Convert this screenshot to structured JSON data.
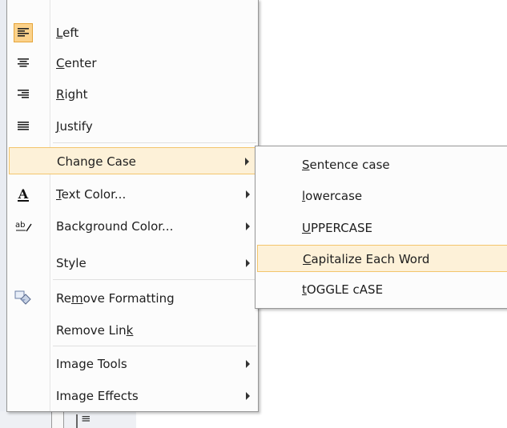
{
  "main_menu": {
    "items": [
      {
        "id": "left",
        "pre": "",
        "acc": "L",
        "post": "eft",
        "icon": "align-left-icon"
      },
      {
        "id": "center",
        "pre": "",
        "acc": "C",
        "post": "enter",
        "icon": "align-center-icon"
      },
      {
        "id": "right",
        "pre": "",
        "acc": "R",
        "post": "ight",
        "icon": "align-right-icon"
      },
      {
        "id": "justify",
        "pre": "",
        "acc": "J",
        "post": "ustify",
        "icon": "align-justify-icon"
      },
      {
        "id": "change-case",
        "label": "Change Case"
      },
      {
        "id": "text-color",
        "pre": "",
        "acc": "T",
        "post": "ext Color...",
        "icon": "text-color-icon"
      },
      {
        "id": "background-color",
        "label": "Background Color...",
        "icon": "background-color-icon"
      },
      {
        "id": "style",
        "label": "Style"
      },
      {
        "id": "remove-formatting",
        "pre": "Re",
        "acc": "m",
        "post": "ove Formatting",
        "icon": "remove-formatting-icon"
      },
      {
        "id": "remove-link",
        "pre": "Remove Lin",
        "acc": "k",
        "post": ""
      },
      {
        "id": "image-tools",
        "label": "Image Tools"
      },
      {
        "id": "image-effects",
        "label": "Image Effects"
      }
    ],
    "icon_glyphs": {
      "text_color": "A",
      "background_color": "ab"
    }
  },
  "sub_menu": {
    "items": [
      {
        "id": "sentence-case",
        "pre": "",
        "acc": "S",
        "post": "entence case"
      },
      {
        "id": "lowercase",
        "pre": "",
        "acc": "l",
        "post": "owercase"
      },
      {
        "id": "uppercase",
        "pre": "",
        "acc": "U",
        "post": "PPERCASE"
      },
      {
        "id": "capitalize-each-word",
        "pre": "",
        "acc": "C",
        "post": "apitalize Each Word"
      },
      {
        "id": "toggle-case",
        "pre": "",
        "acc": "t",
        "post": "OGGLE cASE"
      }
    ]
  },
  "colors": {
    "highlight_bg": "#fdf1d8",
    "highlight_border": "#f3c56c",
    "checked_bg": "#fbd28b"
  }
}
